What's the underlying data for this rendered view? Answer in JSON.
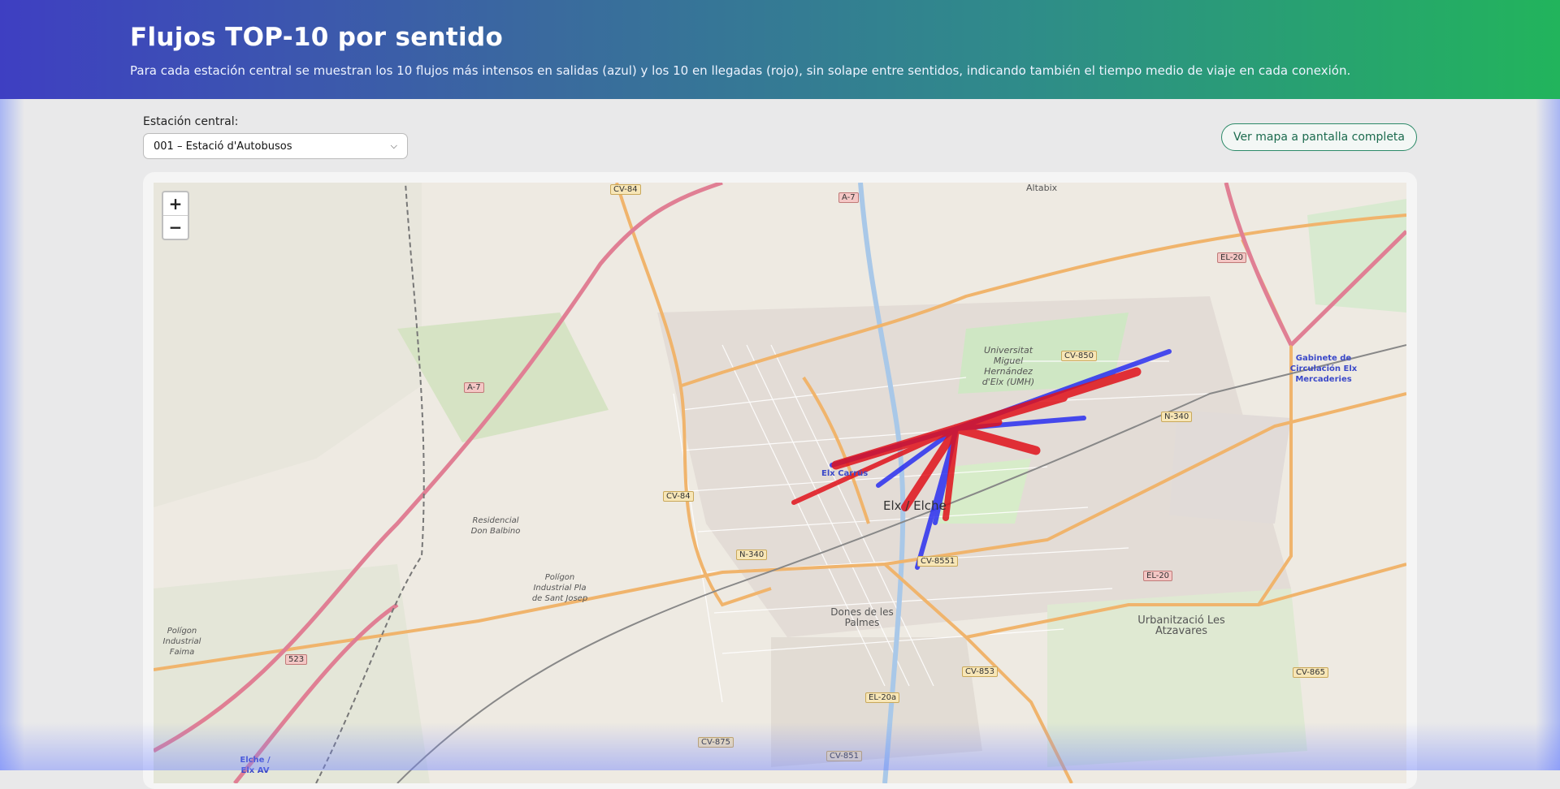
{
  "header": {
    "title": "Flujos TOP-10 por sentido",
    "subtitle": "Para cada estación central se muestran los 10 flujos más intensos en salidas (azul) y los 10 en llegadas (rojo), sin solape entre sentidos, indicando también el tiempo medio de viaje en cada conexión."
  },
  "controls": {
    "station_label": "Estación central:",
    "station_selected": "001 – Estació d'Autobusos",
    "fullscreen_button": "Ver mapa a pantalla completa"
  },
  "map": {
    "zoom_in": "+",
    "zoom_out": "−",
    "colors": {
      "outgoing": "#2a2ff0",
      "incoming": "#e0121b"
    },
    "roads": [
      "CV-84",
      "A-7",
      "CV-850",
      "N-340",
      "EL-20",
      "CV-8551",
      "CV-853",
      "EL-20a",
      "CV-875",
      "CV-851",
      "CV-865",
      "523"
    ],
    "places": {
      "elche": "Elx / Elche",
      "umh": "Universitat Miguel Hernández d'Elx (UMH)",
      "palmes": "Dones de les Palmes",
      "atzavares": "Urbanització Les Atzavares",
      "balbino": "Residencial Don Balbino",
      "poligon": "Polígon Industrial Pla de Sant Josep",
      "faima": "Polígon Industrial Faima",
      "gabinete": "Gabinete de Circulación Elx Mercaderies",
      "altabix": "Altabix",
      "carrus": "Elx Carrús",
      "elxav": "Elche / Elx AV"
    }
  }
}
